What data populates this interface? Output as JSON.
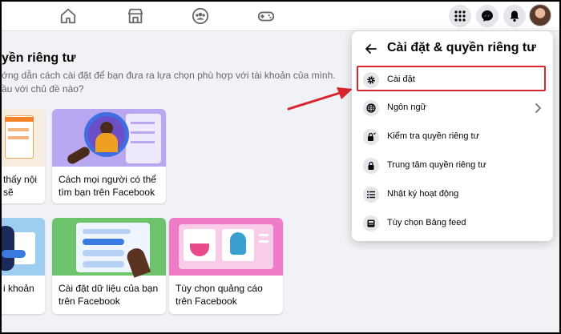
{
  "page": {
    "title": "yền riêng tư",
    "description_line1": "ớng dẫn cách cài đặt để bạn đưa ra lựa chọn phù hợp với tài khoản của mình.",
    "description_line2": "ầu với chủ đề nào?"
  },
  "cards": [
    {
      "label_line1": "thấy nội",
      "label_line2": "sẽ"
    },
    {
      "label_line1": "Cách mọi người có thể",
      "label_line2": "tìm bạn trên Facebook"
    },
    {
      "label_line1": "i khoản",
      "label_line2": ""
    },
    {
      "label_line1": "Cài đặt dữ liệu của bạn",
      "label_line2": "trên Facebook"
    },
    {
      "label_line1": "Tùy chọn quảng cáo",
      "label_line2": "trên Facebook"
    }
  ],
  "menu": {
    "title": "Cài đặt & quyền riêng tư",
    "items": [
      {
        "label": "Cài đặt",
        "icon": "gear-icon"
      },
      {
        "label": "Ngôn ngữ",
        "icon": "globe-icon"
      },
      {
        "label": "Kiểm tra quyền riêng tư",
        "icon": "lock-check-icon"
      },
      {
        "label": "Trung tâm quyền riêng tư",
        "icon": "lock-icon"
      },
      {
        "label": "Nhật ký hoạt động",
        "icon": "list-icon"
      },
      {
        "label": "Tùy chọn Bảng feed",
        "icon": "feed-icon"
      }
    ]
  },
  "colors": {
    "facebook_blue": "#1877f2",
    "highlight_red": "#d9252f",
    "background": "#f0f2f5"
  }
}
